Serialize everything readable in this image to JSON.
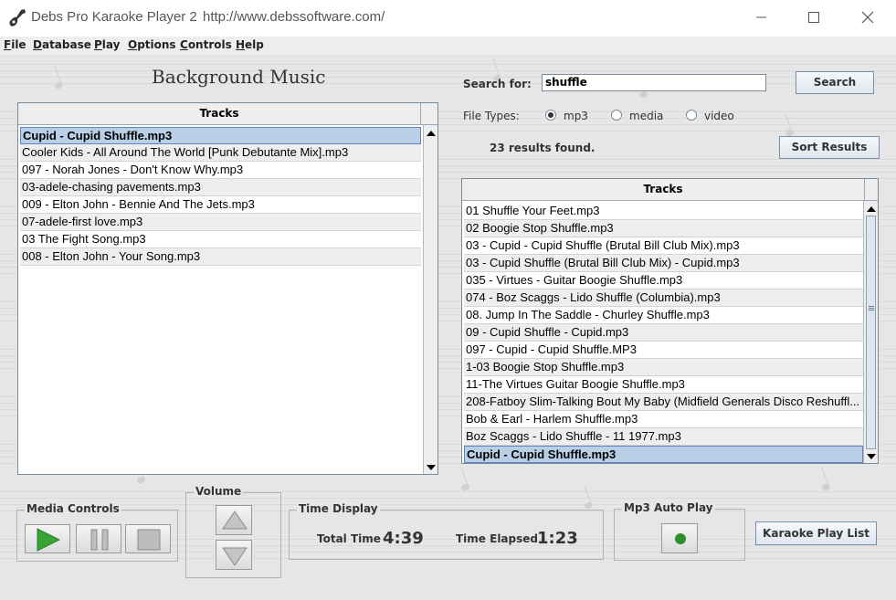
{
  "window": {
    "title": "Debs Pro Karaoke Player 2",
    "url": "http://www.debssoftware.com/"
  },
  "menu": [
    "File",
    "Database",
    "Play",
    "Options",
    "Controls",
    "Help"
  ],
  "left": {
    "heading": "Background Music",
    "table_header": "Tracks",
    "rows": [
      "Cupid - Cupid Shuffle.mp3",
      "Cooler Kids - All Around The World [Punk Debutante Mix].mp3",
      "097 - Norah Jones - Don't Know Why.mp3",
      "03-adele-chasing pavements.mp3",
      "009 - Elton John - Bennie And The Jets.mp3",
      "07-adele-first love.mp3",
      "03 The Fight Song.mp3",
      "008 - Elton John - Your Song.mp3"
    ],
    "selected_index": 0
  },
  "search": {
    "label": "Search for:",
    "value": "shuffle",
    "button": "Search",
    "file_types_label": "File Types:",
    "types": [
      "mp3",
      "media",
      "video"
    ],
    "selected_type": "mp3",
    "results_text": "23  results  found.",
    "sort_button": "Sort Results"
  },
  "right": {
    "table_header": "Tracks",
    "rows": [
      "01 Shuffle Your Feet.mp3",
      "02 Boogie Stop Shuffle.mp3",
      "03 - Cupid - Cupid Shuffle (Brutal Bill Club Mix).mp3",
      "03 - Cupid Shuffle (Brutal Bill Club Mix) - Cupid.mp3",
      "035 - Virtues - Guitar Boogie Shuffle.mp3",
      "074 - Boz Scaggs - Lido Shuffle (Columbia).mp3",
      "08. Jump In The Saddle - Churley Shuffle.mp3",
      "09 - Cupid Shuffle - Cupid.mp3",
      "097 - Cupid - Cupid Shuffle.MP3",
      "1-03 Boogie Stop Shuffle.mp3",
      "11-The Virtues   Guitar Boogie Shuffle.mp3",
      "208-Fatboy Slim-Talking Bout My Baby (Midfield Generals Disco Reshuffl...",
      "Bob & Earl - Harlem Shuffle.mp3",
      "Boz Scaggs - Lido Shuffle - 11 1977.mp3",
      "Cupid - Cupid Shuffle.mp3"
    ],
    "selected_index": 14
  },
  "controls": {
    "media_label": "Media Controls",
    "volume_label": "Volume",
    "time_label": "Time Display",
    "total_time_label": "Total Time",
    "total_time": "4:39",
    "elapsed_label": "Time Elapsed",
    "elapsed": "1:23",
    "autoplay_label": "Mp3  Auto Play",
    "playlist_button": "Karaoke Play List"
  },
  "colors": {
    "background": "#e6e6e6",
    "selection": "#b8cfe5",
    "play_green": "#3aa335",
    "autoplay_dot": "#2f8f2f"
  }
}
